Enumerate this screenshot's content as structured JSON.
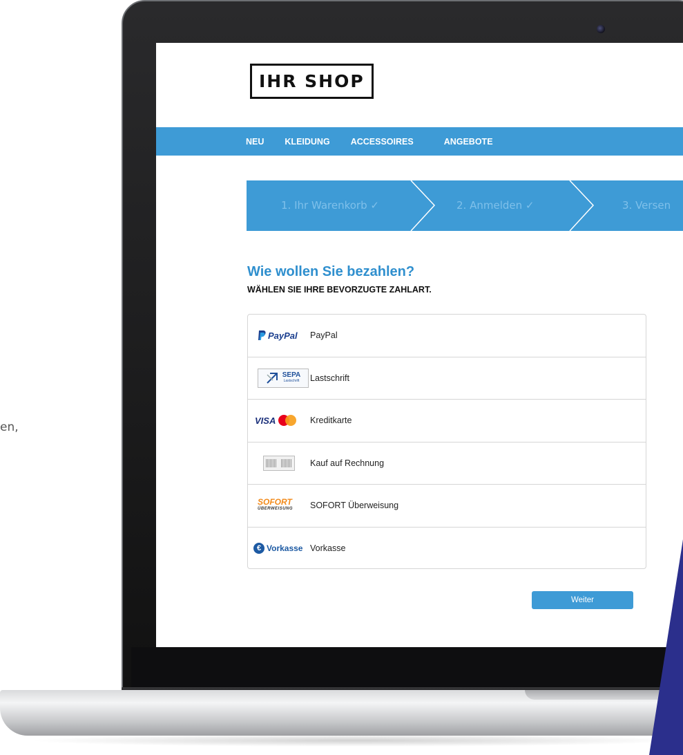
{
  "side_text": "en,",
  "shop": {
    "logo": "IHR SHOP",
    "nav": [
      "NEU",
      "KLEIDUNG",
      "ACCESSOIRES",
      "ANGEBOTE"
    ]
  },
  "steps": [
    {
      "label": "1. Ihr Warenkorb ✓"
    },
    {
      "label": "2. Anmelden ✓"
    },
    {
      "label": "3. Versen"
    }
  ],
  "payment": {
    "heading": "Wie wollen Sie bezahlen?",
    "subheading": "WÄHLEN SIE IHRE BEVORZUGTE ZAHLART.",
    "methods": [
      {
        "label": "PayPal",
        "icon": "paypal-logo",
        "logo_text_a": "PayPal"
      },
      {
        "label": "Lastschrift",
        "icon": "sepa-logo",
        "logo_text_a": "SEPA",
        "logo_text_b": "Lastschrift"
      },
      {
        "label": "Kreditkarte",
        "icon": "visa-mastercard-logo",
        "logo_text_a": "VISA"
      },
      {
        "label": "Kauf auf Rechnung",
        "icon": "invoice-icon"
      },
      {
        "label": "SOFORT Überweisung",
        "icon": "sofort-logo",
        "logo_text_a": "SOFORT",
        "logo_text_b": "ÜBERWEISUNG"
      },
      {
        "label": "Vorkasse",
        "icon": "vorkasse-logo",
        "logo_text_a": "Vorkasse"
      }
    ],
    "continue_label": "Weiter"
  },
  "colors": {
    "accent": "#3e9bd6",
    "heading": "#2f8fce",
    "step_text": "#7fc0ea",
    "decor": "#2b2f8c"
  }
}
